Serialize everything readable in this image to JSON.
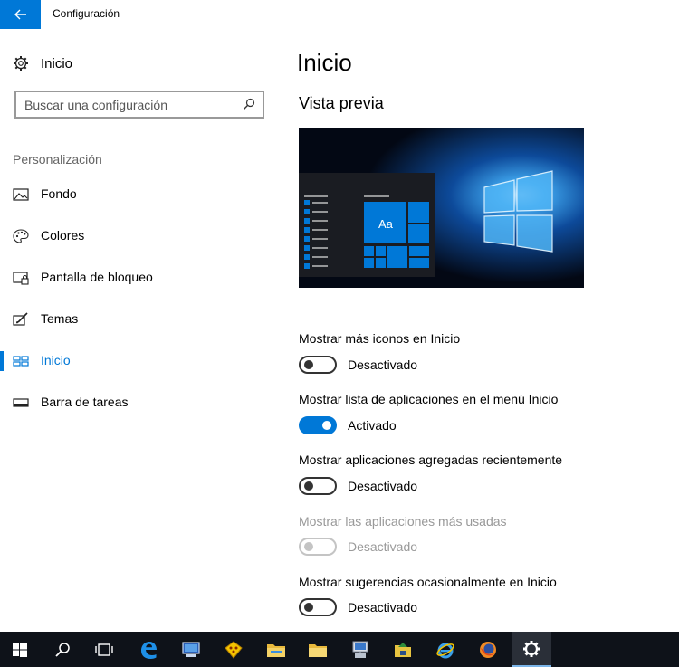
{
  "window": {
    "title": "Configuración",
    "back_icon": "back-arrow-icon"
  },
  "sidebar": {
    "home_label": "Inicio",
    "search_placeholder": "Buscar una configuración",
    "section_label": "Personalización",
    "items": [
      {
        "label": "Fondo",
        "icon": "picture-icon",
        "active": false
      },
      {
        "label": "Colores",
        "icon": "palette-icon",
        "active": false
      },
      {
        "label": "Pantalla de bloqueo",
        "icon": "lock-screen-icon",
        "active": false
      },
      {
        "label": "Temas",
        "icon": "themes-icon",
        "active": false
      },
      {
        "label": "Inicio",
        "icon": "start-icon",
        "active": true
      },
      {
        "label": "Barra de tareas",
        "icon": "taskbar-icon",
        "active": false
      }
    ]
  },
  "main": {
    "title": "Inicio",
    "preview_title": "Vista previa",
    "preview_tile_text": "Aa",
    "settings": [
      {
        "label": "Mostrar más iconos en Inicio",
        "state": "Desactivado",
        "on": false,
        "enabled": true
      },
      {
        "label": "Mostrar lista de aplicaciones en el menú Inicio",
        "state": "Activado",
        "on": true,
        "enabled": true
      },
      {
        "label": "Mostrar aplicaciones agregadas recientemente",
        "state": "Desactivado",
        "on": false,
        "enabled": true
      },
      {
        "label": "Mostrar las aplicaciones más usadas",
        "state": "Desactivado",
        "on": false,
        "enabled": false
      },
      {
        "label": "Mostrar sugerencias ocasionalmente en Inicio",
        "state": "Desactivado",
        "on": false,
        "enabled": true
      }
    ]
  },
  "colors": {
    "accent": "#0078d7",
    "taskbar": "#0e1219"
  },
  "taskbar": {
    "items": [
      "windows-start-icon",
      "search-icon",
      "task-view-icon",
      "edge-icon",
      "computer-icon",
      "store-icon",
      "file-explorer-icon",
      "folder-icon",
      "network-icon",
      "network-folder-icon",
      "internet-explorer-icon",
      "firefox-icon",
      "settings-gear-icon"
    ]
  }
}
